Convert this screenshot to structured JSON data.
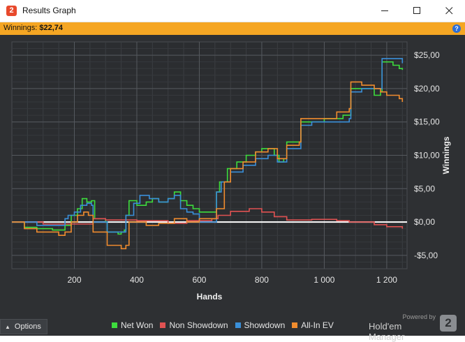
{
  "window": {
    "title": "Results Graph",
    "app_icon_glyph": "2"
  },
  "winnings_bar": {
    "label": "Winnings:",
    "value": "$22,74",
    "color": "#f5a623"
  },
  "bottom": {
    "options_label": "Options",
    "powered_by": "Powered by",
    "brand_name": "Hold'em Manager",
    "brand_logo_glyph": "2"
  },
  "chart_data": {
    "type": "line",
    "xlabel": "Hands",
    "ylabel": "Winnings",
    "xlim": [
      0,
      1265
    ],
    "ylim": [
      -7,
      27
    ],
    "x_ticks": [
      200,
      400,
      600,
      800,
      1000,
      1200
    ],
    "x_tick_labels": [
      "200",
      "400",
      "600",
      "800",
      "1 000",
      "1 200"
    ],
    "y_ticks": [
      -5,
      0,
      5,
      10,
      15,
      20,
      25
    ],
    "y_tick_labels": [
      "-$5,00",
      "$0,00",
      "$5,00",
      "$10,00",
      "$15,00",
      "$20,00",
      "$25,00"
    ],
    "grid": true,
    "zero_line": true,
    "legend_position": "bottom",
    "series": [
      {
        "name": "Net Won",
        "color": "#3ddc3d",
        "points": [
          [
            0,
            0
          ],
          [
            40,
            -0.8
          ],
          [
            80,
            -1
          ],
          [
            130,
            -1.2
          ],
          [
            170,
            -0.5
          ],
          [
            190,
            1
          ],
          [
            210,
            2
          ],
          [
            225,
            3.5
          ],
          [
            240,
            3
          ],
          [
            255,
            3.2
          ],
          [
            265,
            0.5
          ],
          [
            300,
            0
          ],
          [
            305,
            -1.5
          ],
          [
            340,
            -1.8
          ],
          [
            350,
            -1.5
          ],
          [
            360,
            -1.2
          ],
          [
            365,
            1
          ],
          [
            375,
            3.2
          ],
          [
            400,
            2.5
          ],
          [
            430,
            3
          ],
          [
            450,
            3.5
          ],
          [
            470,
            3
          ],
          [
            500,
            3.5
          ],
          [
            520,
            4.5
          ],
          [
            540,
            3.2
          ],
          [
            560,
            2.5
          ],
          [
            580,
            2
          ],
          [
            600,
            1.5
          ],
          [
            650,
            1.5
          ],
          [
            655,
            4.5
          ],
          [
            665,
            6
          ],
          [
            690,
            8
          ],
          [
            720,
            9
          ],
          [
            750,
            10
          ],
          [
            780,
            10.5
          ],
          [
            800,
            11
          ],
          [
            820,
            11
          ],
          [
            840,
            10
          ],
          [
            855,
            9
          ],
          [
            870,
            9.5
          ],
          [
            880,
            12
          ],
          [
            920,
            12
          ],
          [
            925,
            15
          ],
          [
            960,
            15
          ],
          [
            1000,
            15.5
          ],
          [
            1040,
            15.5
          ],
          [
            1060,
            16
          ],
          [
            1080,
            16
          ],
          [
            1085,
            20
          ],
          [
            1120,
            20
          ],
          [
            1160,
            19
          ],
          [
            1180,
            19.5
          ],
          [
            1185,
            24
          ],
          [
            1220,
            23.5
          ],
          [
            1240,
            23
          ],
          [
            1250,
            22.8
          ]
        ]
      },
      {
        "name": "Non Showdown",
        "color": "#e05252",
        "points": [
          [
            0,
            0
          ],
          [
            100,
            -0.3
          ],
          [
            200,
            -0.3
          ],
          [
            260,
            0.5
          ],
          [
            300,
            0.3
          ],
          [
            400,
            0.2
          ],
          [
            500,
            -0.2
          ],
          [
            560,
            0.2
          ],
          [
            640,
            0.5
          ],
          [
            660,
            1
          ],
          [
            700,
            1.6
          ],
          [
            760,
            2
          ],
          [
            800,
            1.5
          ],
          [
            840,
            0.8
          ],
          [
            880,
            0.3
          ],
          [
            960,
            0.4
          ],
          [
            1040,
            0.2
          ],
          [
            1080,
            0
          ],
          [
            1120,
            0
          ],
          [
            1160,
            -0.4
          ],
          [
            1200,
            -0.7
          ],
          [
            1250,
            -1
          ]
        ]
      },
      {
        "name": "Showdown",
        "color": "#3a8fd9",
        "points": [
          [
            0,
            0
          ],
          [
            80,
            -0.5
          ],
          [
            160,
            -0.5
          ],
          [
            170,
            0.5
          ],
          [
            180,
            1
          ],
          [
            200,
            1.5
          ],
          [
            220,
            2.5
          ],
          [
            240,
            2.8
          ],
          [
            255,
            2.5
          ],
          [
            260,
            0
          ],
          [
            300,
            0
          ],
          [
            305,
            -1.5
          ],
          [
            350,
            -1.5
          ],
          [
            360,
            -1.5
          ],
          [
            365,
            1
          ],
          [
            390,
            2.8
          ],
          [
            410,
            4
          ],
          [
            440,
            3.5
          ],
          [
            470,
            3
          ],
          [
            500,
            3.5
          ],
          [
            520,
            4
          ],
          [
            540,
            2
          ],
          [
            560,
            1.5
          ],
          [
            580,
            1.2
          ],
          [
            600,
            0
          ],
          [
            650,
            0
          ],
          [
            655,
            4.5
          ],
          [
            670,
            6
          ],
          [
            700,
            7.5
          ],
          [
            740,
            8.5
          ],
          [
            780,
            9.5
          ],
          [
            820,
            10
          ],
          [
            850,
            9
          ],
          [
            880,
            11
          ],
          [
            920,
            11
          ],
          [
            925,
            14.5
          ],
          [
            960,
            15
          ],
          [
            1000,
            15
          ],
          [
            1040,
            15
          ],
          [
            1080,
            15.5
          ],
          [
            1085,
            19.5
          ],
          [
            1120,
            20
          ],
          [
            1180,
            20
          ],
          [
            1185,
            24.5
          ],
          [
            1240,
            24.5
          ],
          [
            1250,
            23.8
          ]
        ]
      },
      {
        "name": "All-In EV",
        "color": "#f08c2e",
        "points": [
          [
            0,
            0
          ],
          [
            40,
            -1
          ],
          [
            80,
            -1.5
          ],
          [
            150,
            -2
          ],
          [
            170,
            -1.5
          ],
          [
            190,
            0
          ],
          [
            210,
            1
          ],
          [
            230,
            1.5
          ],
          [
            245,
            1
          ],
          [
            260,
            -1.5
          ],
          [
            300,
            -1.5
          ],
          [
            305,
            -3.5
          ],
          [
            350,
            -4
          ],
          [
            365,
            -3.5
          ],
          [
            375,
            0
          ],
          [
            400,
            0
          ],
          [
            430,
            -0.5
          ],
          [
            470,
            -0.2
          ],
          [
            520,
            0.5
          ],
          [
            560,
            0
          ],
          [
            600,
            0.5
          ],
          [
            650,
            0.5
          ],
          [
            655,
            2
          ],
          [
            670,
            2
          ],
          [
            680,
            6
          ],
          [
            700,
            8
          ],
          [
            740,
            9
          ],
          [
            780,
            10.5
          ],
          [
            820,
            11
          ],
          [
            850,
            9.5
          ],
          [
            880,
            11.5
          ],
          [
            920,
            12
          ],
          [
            925,
            15.5
          ],
          [
            960,
            15.5
          ],
          [
            1000,
            15.5
          ],
          [
            1040,
            16.5
          ],
          [
            1080,
            17
          ],
          [
            1085,
            21
          ],
          [
            1120,
            20.5
          ],
          [
            1160,
            20
          ],
          [
            1180,
            19.5
          ],
          [
            1200,
            19
          ],
          [
            1240,
            18.5
          ],
          [
            1250,
            18
          ]
        ]
      }
    ]
  }
}
